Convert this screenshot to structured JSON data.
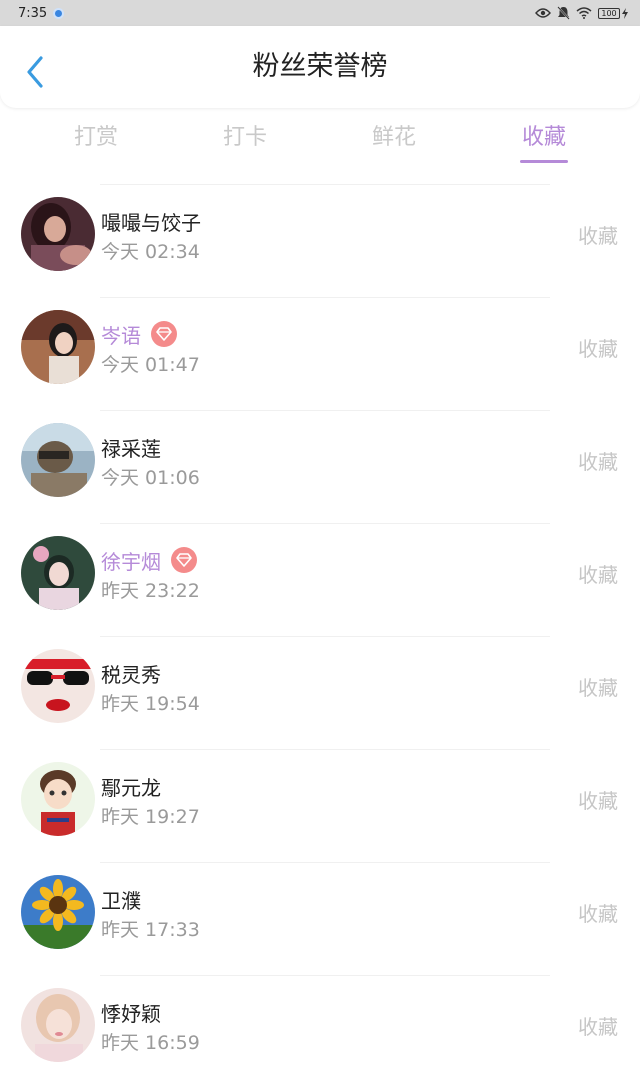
{
  "status_bar": {
    "time": "7:35",
    "battery": "100"
  },
  "header": {
    "title": "粉丝荣誉榜"
  },
  "tabs": [
    {
      "label": "打赏"
    },
    {
      "label": "打卡"
    },
    {
      "label": "鲜花"
    },
    {
      "label": "收藏"
    }
  ],
  "active_tab": "收藏",
  "colors": {
    "accent": "#b58ad8",
    "vip_badge": "#f48b8b",
    "back_arrow": "#3a9be0"
  },
  "rows": [
    {
      "name": "嘬嘬与饺子",
      "time": "今天 02:34",
      "action": "收藏",
      "vip": false
    },
    {
      "name": "岑语",
      "time": "今天 01:47",
      "action": "收藏",
      "vip": true
    },
    {
      "name": "禄采莲",
      "time": "今天 01:06",
      "action": "收藏",
      "vip": false
    },
    {
      "name": "徐宇烟",
      "time": "昨天 23:22",
      "action": "收藏",
      "vip": true
    },
    {
      "name": "税灵秀",
      "time": "昨天 19:54",
      "action": "收藏",
      "vip": false
    },
    {
      "name": "鄢元龙",
      "time": "昨天 19:27",
      "action": "收藏",
      "vip": false
    },
    {
      "name": "卫濮",
      "time": "昨天 17:33",
      "action": "收藏",
      "vip": false
    },
    {
      "name": "悸妤颖",
      "time": "昨天 16:59",
      "action": "收藏",
      "vip": false
    }
  ]
}
